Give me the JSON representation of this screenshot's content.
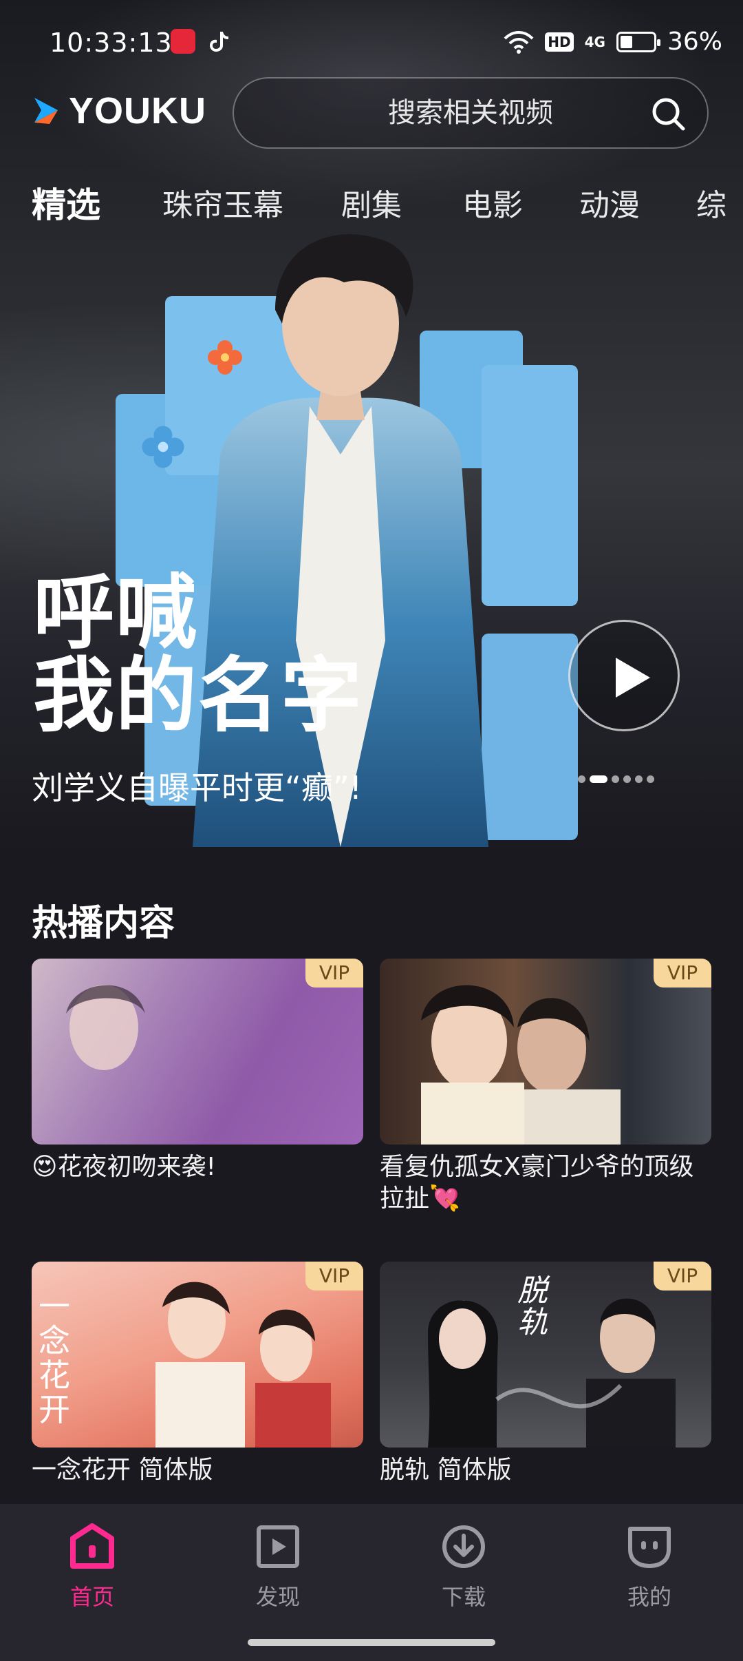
{
  "status_bar": {
    "time": "10:33:13",
    "hd_label": "HD",
    "network_label": "4G",
    "battery": "36%",
    "battery_level": 0.36
  },
  "header": {
    "logo_text": "YOUKU",
    "search_placeholder": "搜索相关视频"
  },
  "tabs": [
    {
      "label": "精选",
      "active": true
    },
    {
      "label": "珠帘玉幕"
    },
    {
      "label": "剧集"
    },
    {
      "label": "电影"
    },
    {
      "label": "动漫"
    },
    {
      "label": "综"
    }
  ],
  "hero": {
    "title_line1": "呼喊",
    "title_line2": "我的名字",
    "subtitle": "刘学义自曝平时更“癫”!",
    "carousel_dots": 6,
    "carousel_active": 1
  },
  "hot": {
    "title": "热播内容",
    "vip_label": "VIP",
    "items": [
      {
        "title": "😍花夜初吻来袭!"
      },
      {
        "title": "看复仇孤女X豪门少爷的顶级拉扯💘"
      },
      {
        "title": "一念花开 简体版",
        "poster_text": "一念花开"
      },
      {
        "title": "脱轨 简体版",
        "poster_text": "脱轨"
      }
    ]
  },
  "bottom_nav": [
    {
      "label": "首页",
      "icon": "home-icon",
      "active": true
    },
    {
      "label": "发现",
      "icon": "discover-play-icon"
    },
    {
      "label": "下载",
      "icon": "download-icon"
    },
    {
      "label": "我的",
      "icon": "profile-face-icon"
    }
  ],
  "colors": {
    "accent": "#ff2a8f",
    "vip_badge": "#f7d79b",
    "background": "#1a191f",
    "nav_bg": "#27262e"
  }
}
